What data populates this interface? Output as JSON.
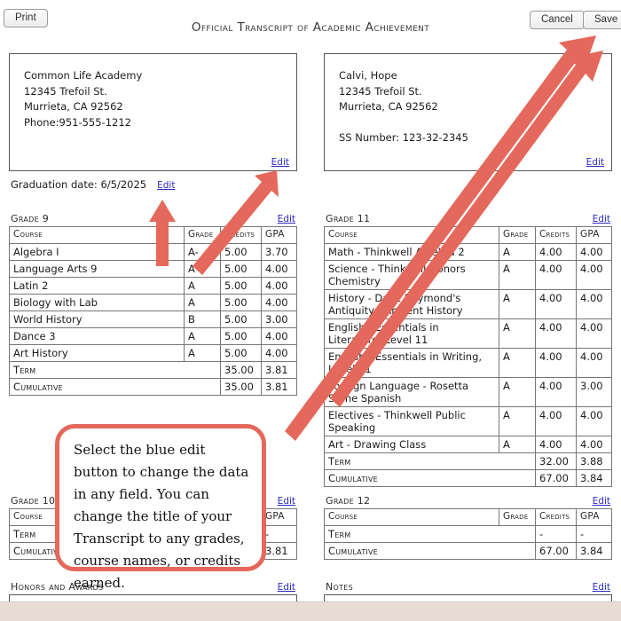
{
  "document": {
    "title": "Official Transcript of Academic Achievement",
    "edit_label": "Edit"
  },
  "colors": {
    "link": "#2b2bc4",
    "annotation": "#e4685b",
    "bottom_bar": "#e9dcd5"
  },
  "school": {
    "lines": [
      "Common Life Academy",
      "12345 Trefoil St.",
      "Murrieta, CA 92562",
      "Phone:951-555-1212"
    ],
    "edit_label": "Edit"
  },
  "student": {
    "lines": [
      "Calvi, Hope",
      "12345 Trefoil St.",
      "Murrieta, CA 92562",
      "",
      "SS Number: 123-32-2345"
    ],
    "edit_label": "Edit"
  },
  "graduation": {
    "text": "Graduation date: 6/5/2025",
    "edit_label": "Edit"
  },
  "columns": {
    "course": "Course",
    "grade": "Grade",
    "credits": "Credits",
    "gpa": "GPA",
    "term": "Term",
    "cumulative": "Cumulative"
  },
  "grade9": {
    "label": "Grade 9",
    "edit_label": "Edit",
    "rows": [
      {
        "course": "Algebra I",
        "grade": "A-",
        "credits": "5.00",
        "gpa": "3.70"
      },
      {
        "course": "Language Arts 9",
        "grade": "A",
        "credits": "5.00",
        "gpa": "4.00"
      },
      {
        "course": "Latin 2",
        "grade": "A",
        "credits": "5.00",
        "gpa": "4.00"
      },
      {
        "course": "Biology with Lab",
        "grade": "A",
        "credits": "5.00",
        "gpa": "4.00"
      },
      {
        "course": "World History",
        "grade": "B",
        "credits": "5.00",
        "gpa": "3.00"
      },
      {
        "course": "Dance 3",
        "grade": "A",
        "credits": "5.00",
        "gpa": "4.00"
      },
      {
        "course": "Art History",
        "grade": "A",
        "credits": "5.00",
        "gpa": "4.00"
      }
    ],
    "term": {
      "credits": "35.00",
      "gpa": "3.81"
    },
    "cumulative": {
      "credits": "35.00",
      "gpa": "3.81"
    }
  },
  "grade11": {
    "label": "Grade 11",
    "edit_label": "Edit",
    "rows": [
      {
        "course": "Math - Thinkwell Algebra 2",
        "grade": "A",
        "credits": "4.00",
        "gpa": "4.00"
      },
      {
        "course": "Science - Thinkwell Honors Chemistry",
        "grade": "A",
        "credits": "4.00",
        "gpa": "4.00"
      },
      {
        "course": "History - Dave Raymond's Antiquity - Ancient History",
        "grade": "A",
        "credits": "4.00",
        "gpa": "4.00"
      },
      {
        "course": "English - Essentials in Literature, Level 11",
        "grade": "A",
        "credits": "4.00",
        "gpa": "4.00"
      },
      {
        "course": "English - Essentials in Writing, Level 11",
        "grade": "A",
        "credits": "4.00",
        "gpa": "4.00"
      },
      {
        "course": "Foreign Language - Rosetta Stone Spanish",
        "grade": "A",
        "credits": "4.00",
        "gpa": "3.00"
      },
      {
        "course": "Electives - Thinkwell Public Speaking",
        "grade": "A",
        "credits": "4.00",
        "gpa": "4.00"
      },
      {
        "course": "Art - Drawing Class",
        "grade": "A",
        "credits": "4.00",
        "gpa": "4.00"
      }
    ],
    "term": {
      "credits": "32.00",
      "gpa": "3.88"
    },
    "cumulative": {
      "credits": "67.00",
      "gpa": "3.84"
    }
  },
  "grade10": {
    "label": "Grade 10",
    "edit_label": "Edit",
    "rows": [],
    "term": {
      "credits": "-",
      "gpa": "-"
    },
    "cumulative": {
      "credits": "",
      "gpa": "3.81"
    }
  },
  "grade12": {
    "label": "Grade 12",
    "edit_label": "Edit",
    "rows": [],
    "term": {
      "credits": "-",
      "gpa": "-"
    },
    "cumulative": {
      "credits": "67.00",
      "gpa": "3.84"
    }
  },
  "honors": {
    "label": "Honors and Awards",
    "edit_label": "Edit"
  },
  "notes": {
    "label": "Notes",
    "edit_label": "Edit"
  },
  "buttons": {
    "print": "Print",
    "cancel": "Cancel",
    "save": "Save"
  },
  "annotation": {
    "text": "Select the blue edit button to change the data in any field. You can change the title of your Transcript to any grades, course names, or credits earned."
  }
}
